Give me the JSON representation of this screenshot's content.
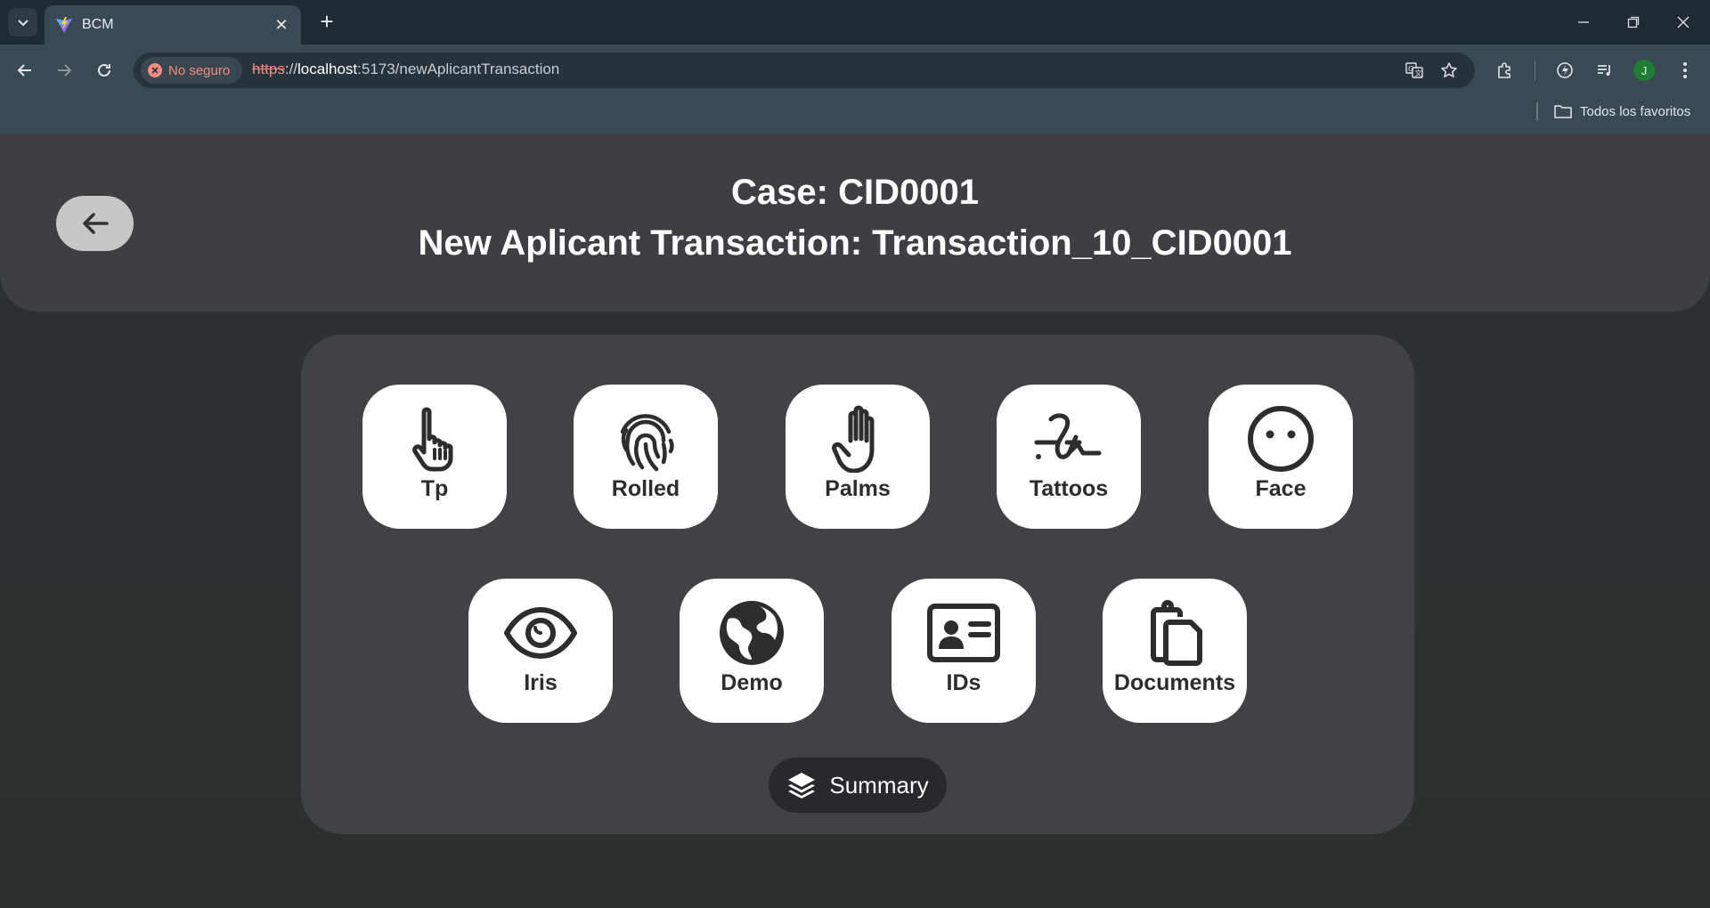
{
  "browser": {
    "tab": {
      "title": "BCM",
      "close": "✕"
    },
    "new_tab": "+",
    "security_label": "No seguro",
    "url": {
      "protocol": "https",
      "separator": "://",
      "host": "localhost",
      "rest": ":5173/newAplicantTransaction"
    },
    "avatar_initial": "J",
    "bookmark_folder": "Todos los favoritos"
  },
  "header": {
    "case_title": "Case: CID0001",
    "transaction_title": "New Aplicant Transaction: Transaction_10_CID0001"
  },
  "tiles": [
    {
      "label": "Tp",
      "icon": "pointing-hand-icon"
    },
    {
      "label": "Rolled",
      "icon": "fingerprint-icon"
    },
    {
      "label": "Palms",
      "icon": "hand-palm-icon"
    },
    {
      "label": "Tattoos",
      "icon": "signature-icon"
    },
    {
      "label": "Face",
      "icon": "face-icon"
    },
    {
      "label": "Iris",
      "icon": "eye-icon"
    },
    {
      "label": "Demo",
      "icon": "globe-icon"
    },
    {
      "label": "IDs",
      "icon": "id-card-icon"
    },
    {
      "label": "Documents",
      "icon": "clipboard-icon"
    }
  ],
  "summary": {
    "label": "Summary",
    "icon": "layers-icon"
  },
  "colors": {
    "tab_bar": "#1f2a33",
    "toolbar": "#3a4a55",
    "header_bg": "#3d3f43",
    "panel_bg": "#404245",
    "tile_bg": "#ffffff",
    "icon_color": "#2d2d2d",
    "summary_bg": "#27292c",
    "insecure_red": "#f28b82"
  }
}
